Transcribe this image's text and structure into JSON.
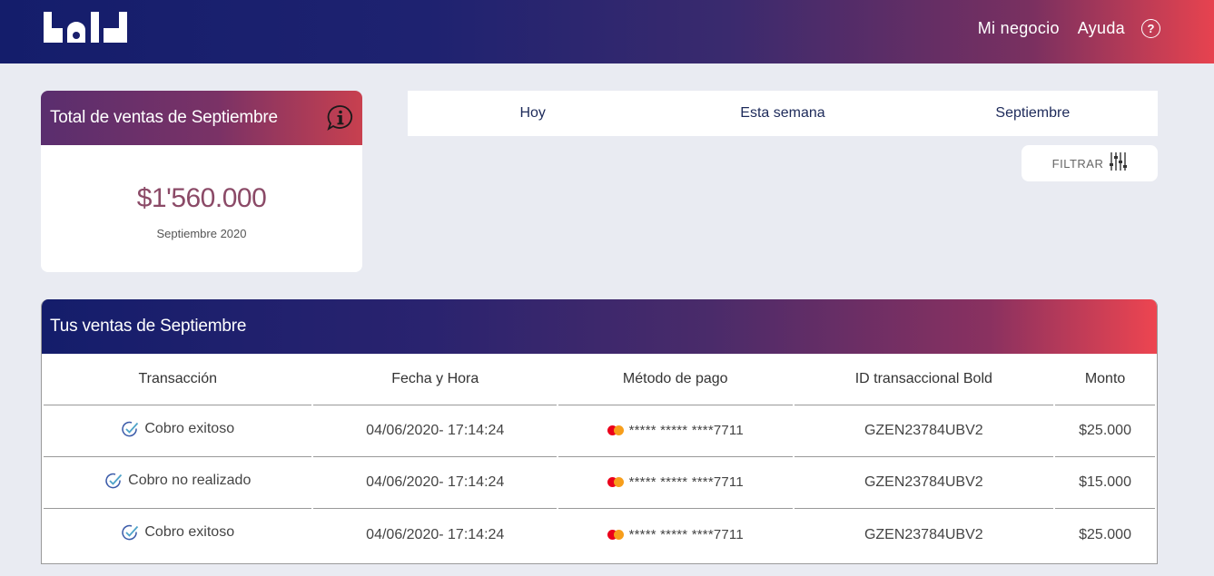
{
  "header": {
    "logo_text": "bold",
    "nav": {
      "business": "Mi negocio",
      "help": "Ayuda",
      "help_icon_glyph": "?"
    }
  },
  "total_card": {
    "title": "Total de ventas de Septiembre",
    "amount": "$1'560.000",
    "subtitle": "Septiembre 2020",
    "info_icon": "info-chat-icon"
  },
  "period_tabs": [
    "Hoy",
    "Esta semana",
    "Septiembre"
  ],
  "filter": {
    "label": "FILTRAR",
    "icon": "sliders-icon"
  },
  "sales": {
    "title": "Tus ventas de Septiembre",
    "columns": [
      "Transacción",
      "Fecha y Hora",
      "Método de pago",
      "ID transaccional Bold",
      "Monto"
    ],
    "rows": [
      {
        "status": "Cobro exitoso",
        "datetime": "04/06/2020- 17:14:24",
        "card": "***** ***** ****7711",
        "id": "GZEN23784UBV2",
        "amount": "$25.000"
      },
      {
        "status": "Cobro no realizado",
        "datetime": "04/06/2020- 17:14:24",
        "card": "***** ***** ****7711",
        "id": "GZEN23784UBV2",
        "amount": "$15.000"
      },
      {
        "status": "Cobro exitoso",
        "datetime": "04/06/2020- 17:14:24",
        "card": "***** ***** ****7711",
        "id": "GZEN23784UBV2",
        "amount": "$25.000"
      }
    ]
  },
  "colors": {
    "header_start": "#141d6b",
    "header_end": "#e7434f",
    "amount": "#8b4a67",
    "check": "#3b5ba9",
    "mastercard_red": "#eb001b",
    "mastercard_orange": "#f79e1b"
  }
}
